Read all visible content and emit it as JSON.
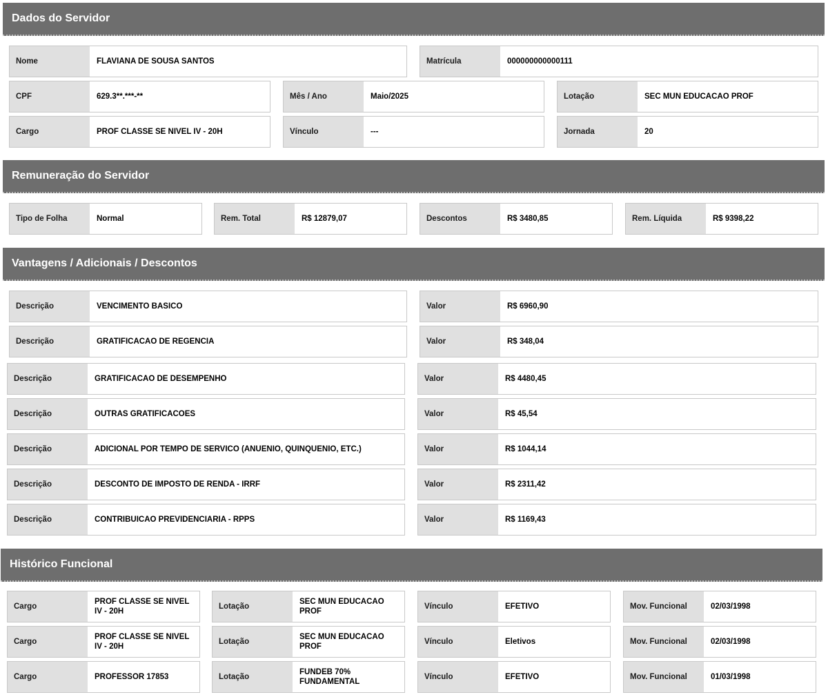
{
  "dados": {
    "title": "Dados do Servidor",
    "nome_label": "Nome",
    "nome": "FLAVIANA DE SOUSA SANTOS",
    "matricula_label": "Matrícula",
    "matricula": "000000000000111",
    "cpf_label": "CPF",
    "cpf": "629.3**.***-**",
    "mes_label": "Mês / Ano",
    "mes": "Maio/2025",
    "lotacao_label": "Lotação",
    "lotacao": "SEC MUN EDUCACAO PROF",
    "cargo_label": "Cargo",
    "cargo": "PROF CLASSE SE NIVEL IV - 20H",
    "vinculo_label": "Vínculo",
    "vinculo": "---",
    "jornada_label": "Jornada",
    "jornada": "20"
  },
  "remuneracao": {
    "title": "Remuneração do Servidor",
    "tipo_label": "Tipo de Folha",
    "tipo": "Normal",
    "total_label": "Rem. Total",
    "total": "R$ 12879,07",
    "descontos_label": "Descontos",
    "descontos": "R$ 3480,85",
    "liquida_label": "Rem. Líquida",
    "liquida": "R$ 9398,22"
  },
  "vantagens": {
    "title": "Vantagens / Adicionais / Descontos",
    "desc_label": "Descrição",
    "valor_label": "Valor",
    "rows": [
      {
        "descricao": "VENCIMENTO BASICO",
        "valor": "R$ 6960,90"
      },
      {
        "descricao": "GRATIFICACAO DE REGENCIA",
        "valor": "R$ 348,04"
      },
      {
        "descricao": "GRATIFICACAO DE DESEMPENHO",
        "valor": "R$ 4480,45"
      },
      {
        "descricao": "OUTRAS GRATIFICACOES",
        "valor": "R$ 45,54"
      },
      {
        "descricao": "ADICIONAL POR TEMPO DE SERVICO (ANUENIO, QUINQUENIO, ETC.)",
        "valor": "R$ 1044,14"
      },
      {
        "descricao": "DESCONTO DE IMPOSTO DE RENDA - IRRF",
        "valor": "R$ 2311,42"
      },
      {
        "descricao": "CONTRIBUICAO PREVIDENCIARIA - RPPS",
        "valor": "R$ 1169,43"
      }
    ]
  },
  "historico": {
    "title": "Histórico Funcional",
    "cargo_label": "Cargo",
    "lotacao_label": "Lotação",
    "vinculo_label": "Vínculo",
    "mov_label": "Mov. Funcional",
    "rows": [
      {
        "cargo": "PROF CLASSE SE NIVEL IV - 20H",
        "lotacao": "SEC MUN EDUCACAO PROF",
        "vinculo": "EFETIVO",
        "mov": "02/03/1998"
      },
      {
        "cargo": "PROF CLASSE SE NIVEL IV - 20H",
        "lotacao": "SEC MUN EDUCACAO PROF",
        "vinculo": "Eletivos",
        "mov": "02/03/1998"
      },
      {
        "cargo": "PROFESSOR 17853",
        "lotacao": "FUNDEB 70% FUNDAMENTAL",
        "vinculo": "EFETIVO",
        "mov": "01/03/1998"
      }
    ]
  }
}
